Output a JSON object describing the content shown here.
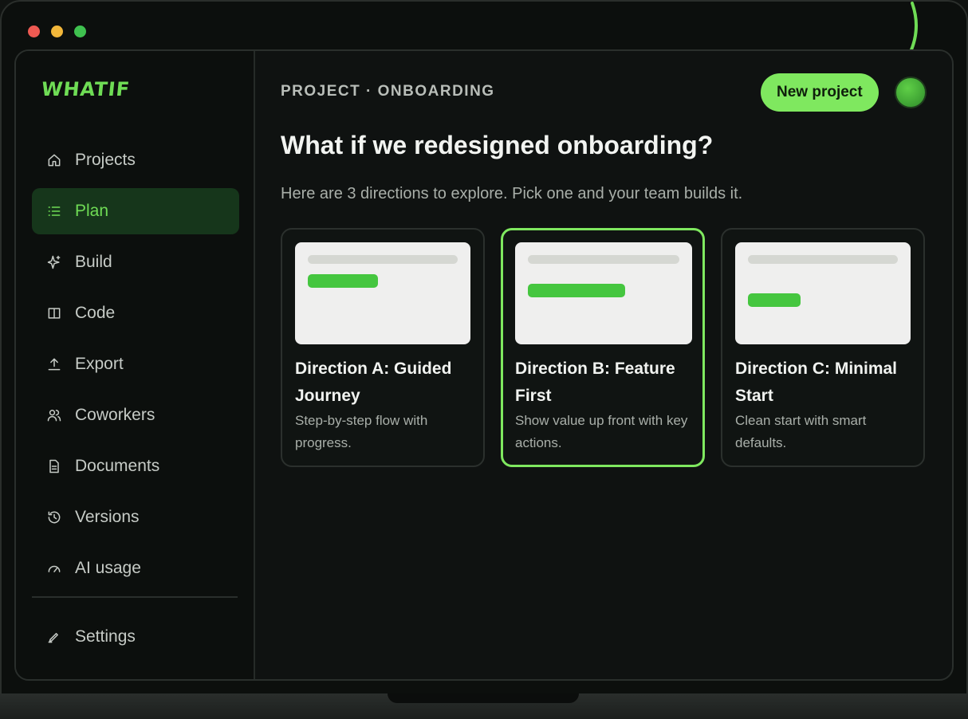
{
  "window": {
    "controls": [
      "close",
      "minimize",
      "zoom"
    ]
  },
  "sidebar": {
    "logo": "WHATIF",
    "items": [
      {
        "label": "Projects",
        "icon": "home-icon"
      },
      {
        "label": "Plan",
        "icon": "list-icon",
        "active": true
      },
      {
        "label": "Build",
        "icon": "sparkle-icon"
      },
      {
        "label": "Code",
        "icon": "columns-icon"
      },
      {
        "label": "Export",
        "icon": "upload-icon"
      },
      {
        "label": "Coworkers",
        "icon": "users-icon"
      },
      {
        "label": "Documents",
        "icon": "document-icon"
      },
      {
        "label": "Versions",
        "icon": "history-icon"
      },
      {
        "label": "AI usage",
        "icon": "gauge-icon"
      }
    ],
    "settings": {
      "label": "Settings",
      "icon": "pen-icon"
    }
  },
  "header": {
    "breadcrumb": "PROJECT · ONBOARDING",
    "new_project_label": "New project"
  },
  "main": {
    "title": "What if we redesigned onboarding?",
    "subtitle": "Here are 3 directions to explore. Pick one and your team builds it.",
    "cards": [
      {
        "title": "Direction A: Guided Journey",
        "description": "Step-by-step flow with progress.",
        "selected": false
      },
      {
        "title": "Direction B: Feature First",
        "description": "Show value up front with key actions.",
        "selected": true
      },
      {
        "title": "Direction C: Minimal Start",
        "description": "Clean start with smart defaults.",
        "selected": false
      }
    ]
  },
  "colors": {
    "accent": "#7fe85f",
    "active_nav_bg": "#16361b",
    "background": "#0f1211"
  }
}
